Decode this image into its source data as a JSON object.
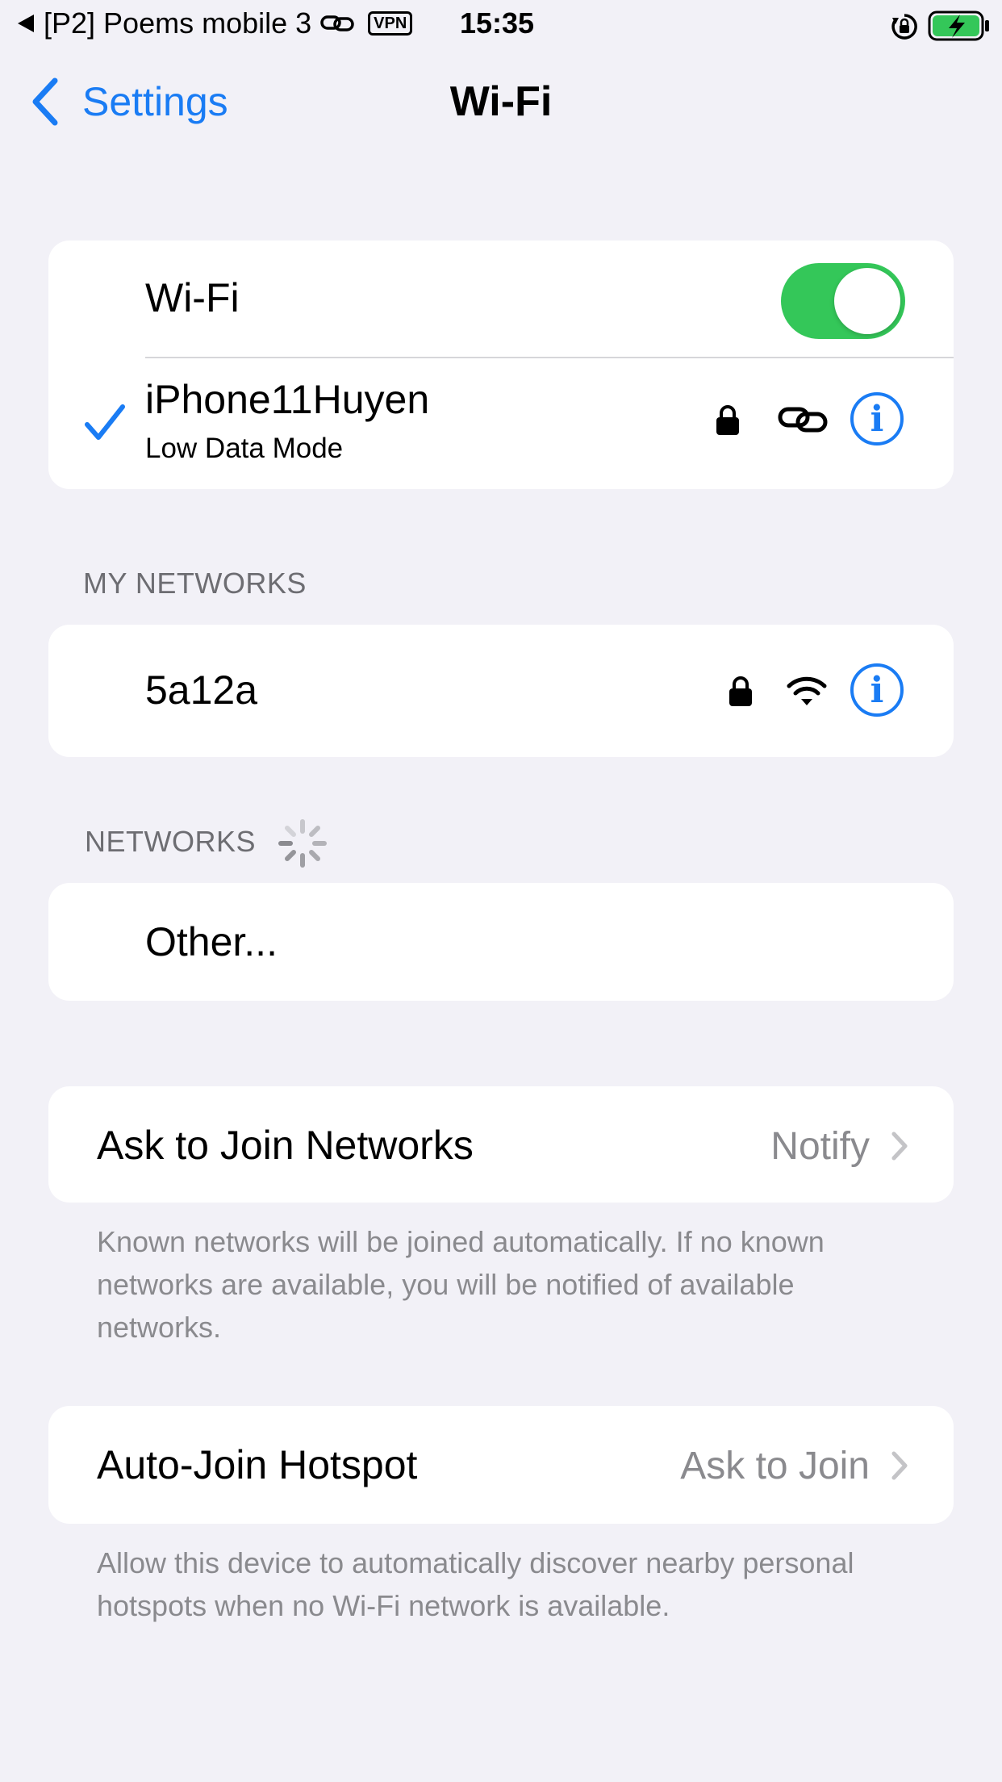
{
  "status_bar": {
    "back_app": "[P2] Poems mobile 3",
    "vpn_label": "VPN",
    "time": "15:35",
    "battery_color": "#34c759"
  },
  "nav": {
    "back_label": "Settings",
    "title": "Wi-Fi"
  },
  "wifi_card": {
    "wifi_label": "Wi-Fi",
    "wifi_enabled": true,
    "connected_network": {
      "name": "iPhone11Huyen",
      "subtitle": "Low Data Mode",
      "icons": [
        "checkmark-icon",
        "lock-icon",
        "link-icon",
        "info-icon"
      ]
    }
  },
  "my_networks": {
    "header": "MY NETWORKS",
    "items": [
      {
        "name": "5a12a",
        "icons": [
          "lock-icon",
          "wifi-signal-icon",
          "info-icon"
        ]
      }
    ]
  },
  "networks": {
    "header": "NETWORKS",
    "other_label": "Other..."
  },
  "ask_to_join": {
    "label": "Ask to Join Networks",
    "value": "Notify",
    "footer": "Known networks will be joined automatically. If no known networks are available, you will be notified of available networks."
  },
  "auto_join_hotspot": {
    "label": "Auto-Join Hotspot",
    "value": "Ask to Join",
    "footer": "Allow this device to automatically discover nearby personal hotspots when no Wi-Fi network is available."
  },
  "colors": {
    "accent": "#1a7cf4",
    "toggle_on": "#34c759",
    "background": "#f2f1f7"
  }
}
